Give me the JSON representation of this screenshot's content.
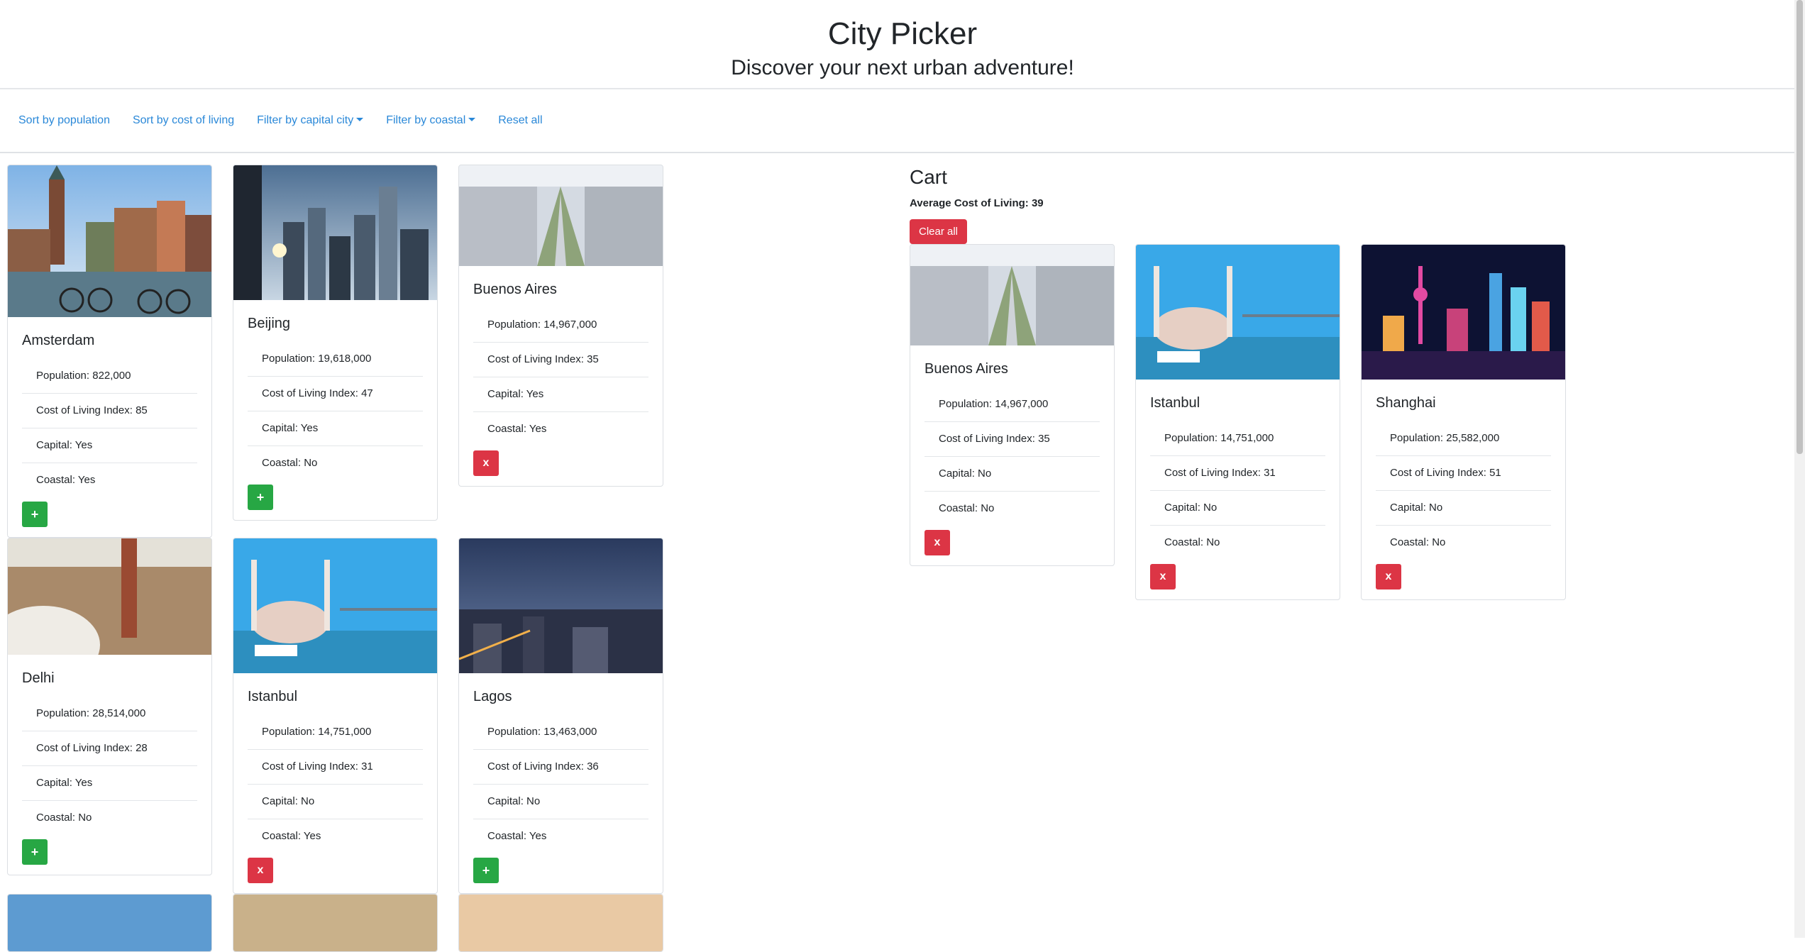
{
  "header": {
    "title": "City Picker",
    "subtitle": "Discover your next urban adventure!"
  },
  "nav": {
    "sort_population": "Sort by population",
    "sort_cost": "Sort by cost of living",
    "filter_capital": "Filter by capital city",
    "filter_coastal": "Filter by coastal",
    "reset": "Reset all"
  },
  "cities": [
    {
      "name": "Amsterdam",
      "population": "Population: 822,000",
      "cost": "Cost of Living Index: 85",
      "capital": "Capital: Yes",
      "coastal": "Coastal: Yes",
      "action": "+"
    },
    {
      "name": "Beijing",
      "population": "Population: 19,618,000",
      "cost": "Cost of Living Index: 47",
      "capital": "Capital: Yes",
      "coastal": "Coastal: No",
      "action": "+"
    },
    {
      "name": "Buenos Aires",
      "population": "Population: 14,967,000",
      "cost": "Cost of Living Index: 35",
      "capital": "Capital: Yes",
      "coastal": "Coastal: Yes",
      "action": "x"
    },
    {
      "name": "Delhi",
      "population": "Population: 28,514,000",
      "cost": "Cost of Living Index: 28",
      "capital": "Capital: Yes",
      "coastal": "Coastal: No",
      "action": "+"
    },
    {
      "name": "Istanbul",
      "population": "Population: 14,751,000",
      "cost": "Cost of Living Index: 31",
      "capital": "Capital: No",
      "coastal": "Coastal: Yes",
      "action": "x"
    },
    {
      "name": "Lagos",
      "population": "Population: 13,463,000",
      "cost": "Cost of Living Index: 36",
      "capital": "Capital: No",
      "coastal": "Coastal: Yes",
      "action": "+"
    }
  ],
  "cart": {
    "title": "Cart",
    "average": "Average Cost of Living: 39",
    "clear_label": "Clear all",
    "items": [
      {
        "name": "Buenos Aires",
        "population": "Population: 14,967,000",
        "cost": "Cost of Living Index: 35",
        "capital": "Capital: No",
        "coastal": "Coastal: No",
        "action": "x"
      },
      {
        "name": "Istanbul",
        "population": "Population: 14,751,000",
        "cost": "Cost of Living Index: 31",
        "capital": "Capital: No",
        "coastal": "Coastal: No",
        "action": "x"
      },
      {
        "name": "Shanghai",
        "population": "Population: 25,582,000",
        "cost": "Cost of Living Index: 51",
        "capital": "Capital: No",
        "coastal": "Coastal: No",
        "action": "x"
      }
    ]
  },
  "colors": {
    "link": "#2a88d8",
    "add": "#27a744",
    "remove": "#dc3545"
  }
}
